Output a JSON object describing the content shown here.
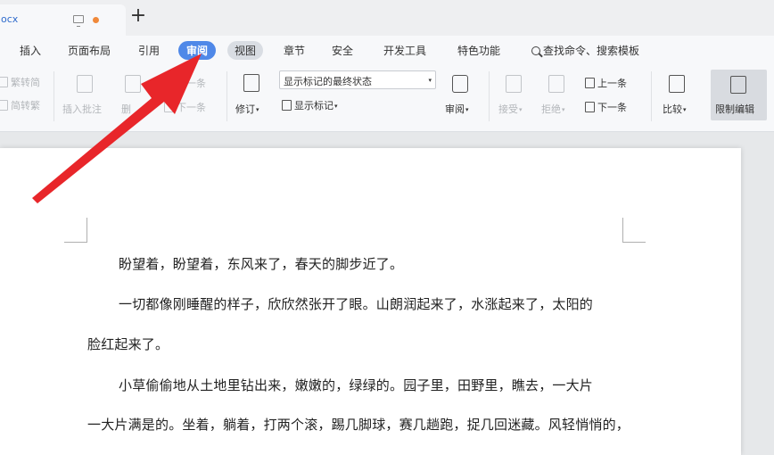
{
  "tabs": {
    "doc_title": "ocx",
    "new_tab": "+"
  },
  "menu": {
    "items": [
      "插入",
      "页面布局",
      "引用",
      "审阅",
      "视图",
      "章节",
      "安全",
      "开发工具",
      "特色功能"
    ],
    "active": "审阅",
    "search": "查找命令、搜索模板"
  },
  "ribbon": {
    "trad_to_simp": "繁转简",
    "simp_to_trad": "简转繁",
    "insert_comment": "插入批注",
    "delete_comment": "删",
    "prev_comment": "上一条",
    "next_comment": "下一条",
    "revise": "修订",
    "markup_state": "显示标记的最终状态",
    "show_markup": "显示标记",
    "review": "审阅",
    "accept": "接受",
    "reject": "拒绝",
    "prev_change": "上一条",
    "next_change": "下一条",
    "compare": "比较",
    "restrict_edit": "限制编辑"
  },
  "document": {
    "lines": [
      "盼望着，盼望着，东风来了，春天的脚步近了。",
      "一切都像刚睡醒的样子，欣欣然张开了眼。山朗润起来了，水涨起来了，太阳的",
      "脸红起来了。",
      "小草偷偷地从土地里钻出来，嫩嫩的，绿绿的。园子里，田野里，瞧去，一大片",
      "一大片满是的。坐着，躺着，打两个滚，踢几脚球，赛几趟跑，捉几回迷藏。风轻悄悄的，"
    ]
  },
  "colors": {
    "accent": "#4f88e8",
    "arrow": "#e8262a",
    "modified_dot": "#f0893a"
  }
}
